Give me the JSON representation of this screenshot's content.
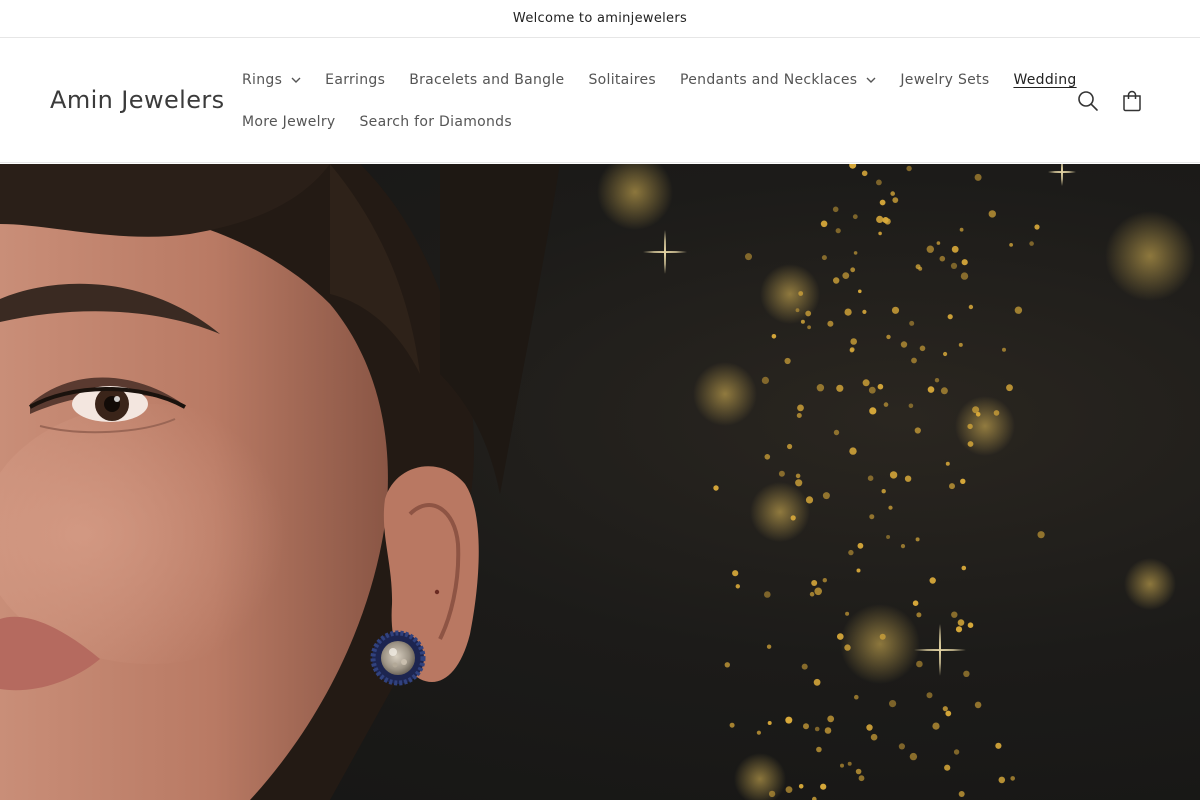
{
  "announcement": {
    "text": "Welcome to aminjewelers"
  },
  "header": {
    "brand": "Amin Jewelers",
    "nav": [
      {
        "label": "Rings",
        "dropdown": true,
        "active": false
      },
      {
        "label": "Earrings",
        "dropdown": false,
        "active": false
      },
      {
        "label": "Bracelets and Bangle",
        "dropdown": false,
        "active": false
      },
      {
        "label": "Solitaires",
        "dropdown": false,
        "active": false
      },
      {
        "label": "Pendants and Necklaces",
        "dropdown": true,
        "active": false
      },
      {
        "label": "Jewelry Sets",
        "dropdown": false,
        "active": false
      },
      {
        "label": "Wedding",
        "dropdown": false,
        "active": true
      },
      {
        "label": "More Jewelry",
        "dropdown": false,
        "active": false
      },
      {
        "label": "Search for Diamonds",
        "dropdown": false,
        "active": false
      }
    ],
    "icons": {
      "search": "search-icon",
      "cart": "shopping-bag-icon"
    }
  },
  "hero": {
    "image": "woman-wearing-sapphire-halo-stud-earring-on-dark-gold-sparkle-background"
  },
  "colors": {
    "text": "#3b3b3b",
    "border": "#e6e6e6",
    "hero_bg": "#1c1b19",
    "sparkle": "#d8a93a"
  }
}
